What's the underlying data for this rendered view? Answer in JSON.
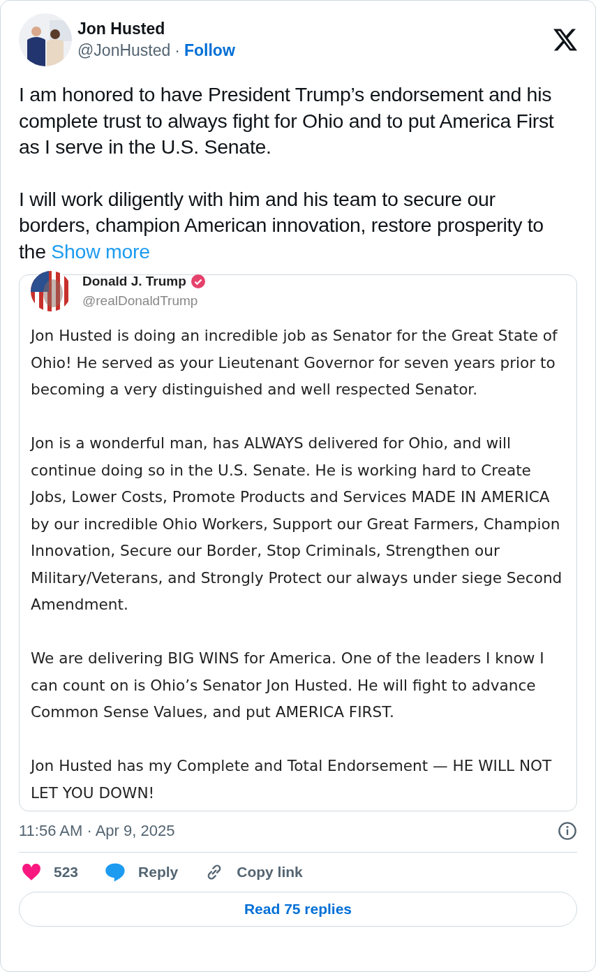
{
  "author": {
    "name": "Jon Husted",
    "handle": "@JonHusted",
    "separator": "·",
    "follow": "Follow"
  },
  "text": [
    "I am honored to have President Trump’s endorsement and his complete trust to always fight for Ohio and to put America First as I serve in the U.S. Senate.",
    "I will work diligently with him and his team to secure our borders, champion American innovation, restore prosperity to the"
  ],
  "show_more": "Show more",
  "quoted": {
    "name": "Donald J. Trump",
    "verified": true,
    "handle": "@realDonaldTrump",
    "paragraphs": [
      "Jon Husted is doing an incredible job as Senator for the Great State of Ohio! He served as your Lieutenant Governor for seven years prior to becoming a very distinguished and well respected Senator.",
      "Jon is a wonderful man, has ALWAYS delivered for Ohio, and will continue doing so in the U.S. Senate. He is working hard to Create Jobs, Lower Costs, Promote Products and Services MADE IN AMERICA by our incredible Ohio Workers, Support our Great Farmers, Champion Innovation, Secure our Border, Stop Criminals, Strengthen our Military/Veterans, and Strongly Protect our always under siege Second Amendment.",
      "We are delivering BIG WINS for America. One of the leaders I know I can count on is Ohio’s Senator Jon Husted. He will fight to advance Common Sense Values, and put AMERICA FIRST.",
      "Jon Husted has my Complete and Total Endorsement — HE WILL NOT LET YOU DOWN!"
    ]
  },
  "timestamp": "11:56 AM · Apr 9, 2025",
  "actions": [
    {
      "kind": "like",
      "label": "523"
    },
    {
      "kind": "reply",
      "label": "Reply"
    },
    {
      "kind": "copy",
      "label": "Copy link"
    }
  ],
  "read_replies": "Read 75 replies"
}
